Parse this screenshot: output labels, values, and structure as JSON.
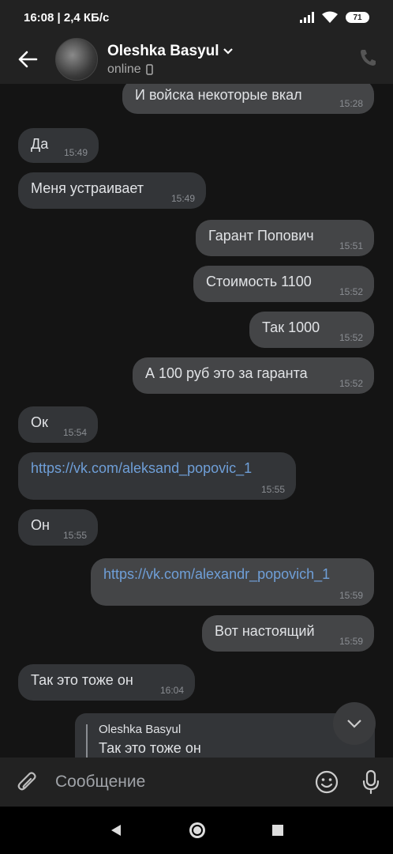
{
  "status": {
    "time_net": "16:08 | 2,4 КБ/с",
    "battery": "71"
  },
  "header": {
    "name": "Oleshka Basyul",
    "status": "online"
  },
  "messages": [
    {
      "text": "И войска некоторые вкал",
      "time": "15:28",
      "dir": "out"
    },
    {
      "text": "Да",
      "time": "15:49",
      "dir": "in"
    },
    {
      "text": "Меня устраивает",
      "time": "15:49",
      "dir": "in"
    },
    {
      "text": "Гарант Попович",
      "time": "15:51",
      "dir": "out"
    },
    {
      "text": "Стоимость 1100",
      "time": "15:52",
      "dir": "out"
    },
    {
      "text": "Так 1000",
      "time": "15:52",
      "dir": "out"
    },
    {
      "text": "А 100 руб это за гаранта",
      "time": "15:52",
      "dir": "out"
    },
    {
      "text": "Ок",
      "time": "15:54",
      "dir": "in"
    },
    {
      "text": "https://vk.com/aleksand_popovic_1",
      "time": "15:55",
      "dir": "in"
    },
    {
      "text": "Он",
      "time": "15:55",
      "dir": "in"
    },
    {
      "text": "https://vk.com/alexandr_popovich_1",
      "time": "15:59",
      "dir": "out"
    },
    {
      "text": "Вот настоящий",
      "time": "15:59",
      "dir": "out"
    },
    {
      "text": "Так это тоже он",
      "time": "16:04",
      "dir": "in"
    }
  ],
  "reply": {
    "name": "Oleshka Basyul",
    "text": "Так это тоже он"
  },
  "composer": {
    "placeholder": "Сообщение"
  }
}
